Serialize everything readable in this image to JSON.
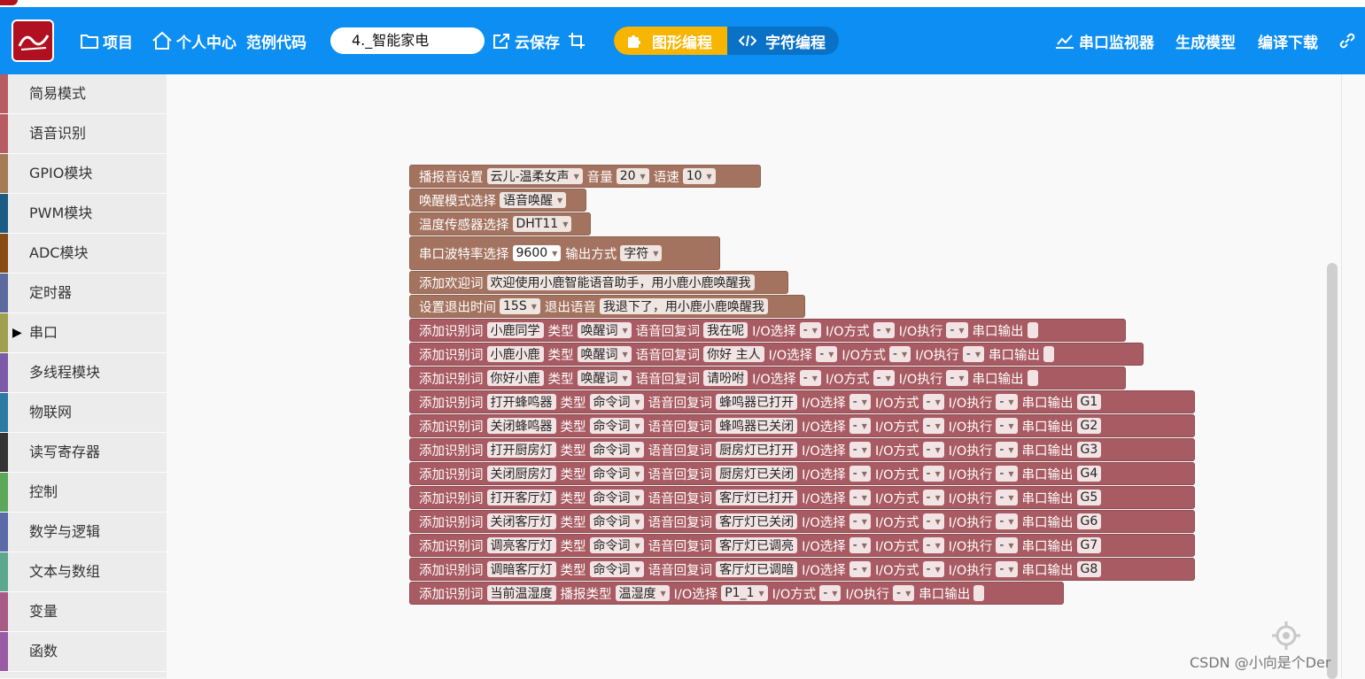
{
  "header": {
    "nav": [
      "项目",
      "个人中心",
      "范例代码"
    ],
    "project_name": "4._智能家电",
    "cloud_save": "云保存",
    "mode_graphic": "图形编程",
    "mode_text": "字符编程",
    "serial_monitor": "串口监视器",
    "generate_model": "生成模型",
    "compile_download": "编译下载",
    "colors": {
      "header": "#0c8ef3",
      "mode_active": "#f8b500"
    }
  },
  "sidebar": {
    "items": [
      {
        "label": "简易模式",
        "color": "#b85c63"
      },
      {
        "label": "语音识别",
        "color": "#b85c63"
      },
      {
        "label": "GPIO模块",
        "color": "#a57b56"
      },
      {
        "label": "PWM模块",
        "color": "#1b5c85"
      },
      {
        "label": "ADC模块",
        "color": "#8a4a16"
      },
      {
        "label": "定时器",
        "color": "#5c6aa0"
      },
      {
        "label": "串口",
        "color": "#a0a050"
      },
      {
        "label": "多线程模块",
        "color": "#7b5ba8"
      },
      {
        "label": "物联网",
        "color": "#2a7aa3"
      },
      {
        "label": "读写寄存器",
        "color": "#333333"
      },
      {
        "label": "控制",
        "color": "#5ba85b"
      },
      {
        "label": "数学与逻辑",
        "color": "#5b6aa8"
      },
      {
        "label": "文本与数组",
        "color": "#5ba88e"
      },
      {
        "label": "变量",
        "color": "#a85b85"
      },
      {
        "label": "函数",
        "color": "#995ba5"
      }
    ]
  },
  "blocks": {
    "b1": {
      "label": "播报音设置",
      "voice": "云儿-温柔女声",
      "vol_label": "音量",
      "vol": "20",
      "speed_label": "语速",
      "speed": "10"
    },
    "b2": {
      "label": "唤醒模式选择",
      "value": "语音唤醒"
    },
    "b3": {
      "label": "温度传感器选择",
      "value": "DHT11"
    },
    "b4": {
      "label": "串口波特率选择",
      "baud": "9600",
      "out_label": "输出方式",
      "out": "字符"
    },
    "b5": {
      "label": "添加欢迎词",
      "value": "欢迎使用小鹿智能语音助手，用小鹿小鹿唤醒我"
    },
    "b6": {
      "label": "设置退出时间",
      "time": "15S",
      "exit_label": "退出语音",
      "exit_text": "我退下了，用小鹿小鹿唤醒我"
    },
    "labels": {
      "add": "添加识别词",
      "type": "类型",
      "reply": "语音回复词",
      "io_sel": "I/O选择",
      "io_mode": "I/O方式",
      "io_exec": "I/O执行",
      "serial": "串口输出",
      "broadcast_type": "播报类型",
      "dash": "-"
    },
    "rows": [
      {
        "word": "小鹿同学",
        "type": "唤醒词",
        "reply": "我在呢",
        "out": ""
      },
      {
        "word": "小鹿小鹿",
        "type": "唤醒词",
        "reply": "你好 主人",
        "out": ""
      },
      {
        "word": "你好小鹿",
        "type": "唤醒词",
        "reply": "请吩咐",
        "out": ""
      },
      {
        "word": "打开蜂鸣器",
        "type": "命令词",
        "reply": "蜂鸣器已打开",
        "out": "G1"
      },
      {
        "word": "关闭蜂鸣器",
        "type": "命令词",
        "reply": "蜂鸣器已关闭",
        "out": "G2"
      },
      {
        "word": "打开厨房灯",
        "type": "命令词",
        "reply": "厨房灯已打开",
        "out": "G3"
      },
      {
        "word": "关闭厨房灯",
        "type": "命令词",
        "reply": "厨房灯已关闭",
        "out": "G4"
      },
      {
        "word": "打开客厅灯",
        "type": "命令词",
        "reply": "客厅灯已打开",
        "out": "G5"
      },
      {
        "word": "关闭客厅灯",
        "type": "命令词",
        "reply": "客厅灯已关闭",
        "out": "G6"
      },
      {
        "word": "调亮客厅灯",
        "type": "命令词",
        "reply": "客厅灯已调亮",
        "out": "G7"
      },
      {
        "word": "调暗客厅灯",
        "type": "命令词",
        "reply": "客厅灯已调暗",
        "out": "G8"
      }
    ],
    "last": {
      "word": "当前温湿度",
      "btype": "温湿度",
      "io": "P1_1"
    }
  },
  "watermark": "CSDN @小向是个Der"
}
